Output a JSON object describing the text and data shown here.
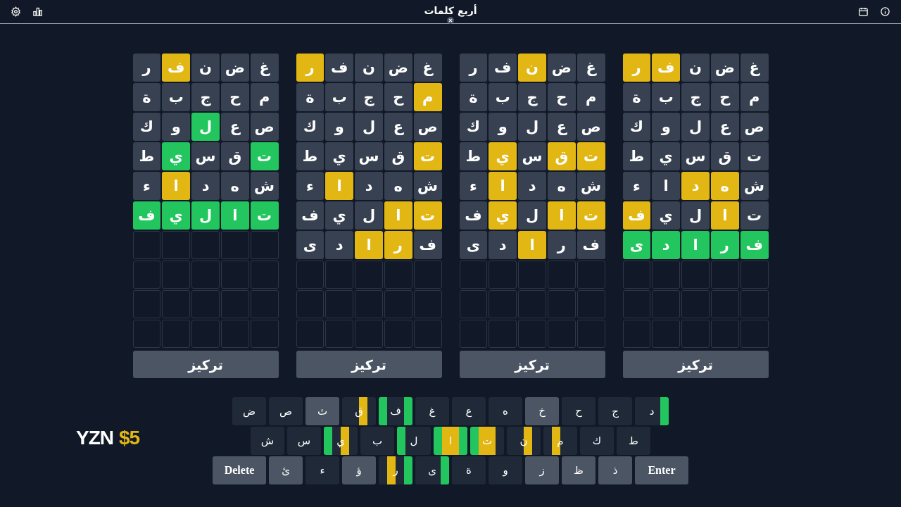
{
  "header": {
    "title": "أربع كلمات"
  },
  "boards": [
    {
      "rows": [
        {
          "tiles": [
            {
              "letter": "غ",
              "color": "#374151"
            },
            {
              "letter": "ض",
              "color": "#374151"
            },
            {
              "letter": "ن",
              "color": "#374151"
            },
            {
              "letter": "ف",
              "color": "#e2b714"
            },
            {
              "letter": "ر",
              "color": "#e2b714"
            }
          ]
        },
        {
          "tiles": [
            {
              "letter": "م",
              "color": "#374151"
            },
            {
              "letter": "ح",
              "color": "#374151"
            },
            {
              "letter": "ج",
              "color": "#374151"
            },
            {
              "letter": "ب",
              "color": "#374151"
            },
            {
              "letter": "ة",
              "color": "#374151"
            }
          ]
        },
        {
          "tiles": [
            {
              "letter": "ص",
              "color": "#374151"
            },
            {
              "letter": "ع",
              "color": "#374151"
            },
            {
              "letter": "ل",
              "color": "#374151"
            },
            {
              "letter": "و",
              "color": "#374151"
            },
            {
              "letter": "ك",
              "color": "#374151"
            }
          ]
        },
        {
          "tiles": [
            {
              "letter": "ت",
              "color": "#374151"
            },
            {
              "letter": "ق",
              "color": "#374151"
            },
            {
              "letter": "س",
              "color": "#374151"
            },
            {
              "letter": "ي",
              "color": "#374151"
            },
            {
              "letter": "ط",
              "color": "#374151"
            }
          ]
        },
        {
          "tiles": [
            {
              "letter": "ش",
              "color": "#374151"
            },
            {
              "letter": "ه",
              "color": "#e2b714"
            },
            {
              "letter": "د",
              "color": "#e2b714"
            },
            {
              "letter": "ا",
              "color": "#374151"
            },
            {
              "letter": "ء",
              "color": "#374151"
            }
          ]
        },
        {
          "tiles": [
            {
              "letter": "ت",
              "color": "#374151"
            },
            {
              "letter": "ا",
              "color": "#e2b714"
            },
            {
              "letter": "ل",
              "color": "#374151"
            },
            {
              "letter": "ي",
              "color": "#374151"
            },
            {
              "letter": "ف",
              "color": "#e2b714"
            }
          ]
        },
        {
          "tiles": [
            {
              "letter": "ف",
              "color": "#22c55e"
            },
            {
              "letter": "ر",
              "color": "#22c55e"
            },
            {
              "letter": "ا",
              "color": "#22c55e"
            },
            {
              "letter": "د",
              "color": "#22c55e"
            },
            {
              "letter": "ى",
              "color": "#22c55e"
            }
          ]
        }
      ],
      "focus": "تركيز"
    },
    {
      "rows": [
        {
          "tiles": [
            {
              "letter": "غ",
              "color": "#374151"
            },
            {
              "letter": "ض",
              "color": "#374151"
            },
            {
              "letter": "ن",
              "color": "#e2b714"
            },
            {
              "letter": "ف",
              "color": "#374151"
            },
            {
              "letter": "ر",
              "color": "#374151"
            }
          ]
        },
        {
          "tiles": [
            {
              "letter": "م",
              "color": "#374151"
            },
            {
              "letter": "ح",
              "color": "#374151"
            },
            {
              "letter": "ج",
              "color": "#374151"
            },
            {
              "letter": "ب",
              "color": "#374151"
            },
            {
              "letter": "ة",
              "color": "#374151"
            }
          ]
        },
        {
          "tiles": [
            {
              "letter": "ص",
              "color": "#374151"
            },
            {
              "letter": "ع",
              "color": "#374151"
            },
            {
              "letter": "ل",
              "color": "#374151"
            },
            {
              "letter": "و",
              "color": "#374151"
            },
            {
              "letter": "ك",
              "color": "#374151"
            }
          ]
        },
        {
          "tiles": [
            {
              "letter": "ت",
              "color": "#e2b714"
            },
            {
              "letter": "ق",
              "color": "#e2b714"
            },
            {
              "letter": "س",
              "color": "#374151"
            },
            {
              "letter": "ي",
              "color": "#e2b714"
            },
            {
              "letter": "ط",
              "color": "#374151"
            }
          ]
        },
        {
          "tiles": [
            {
              "letter": "ش",
              "color": "#374151"
            },
            {
              "letter": "ه",
              "color": "#374151"
            },
            {
              "letter": "د",
              "color": "#374151"
            },
            {
              "letter": "ا",
              "color": "#e2b714"
            },
            {
              "letter": "ء",
              "color": "#374151"
            }
          ]
        },
        {
          "tiles": [
            {
              "letter": "ت",
              "color": "#e2b714"
            },
            {
              "letter": "ا",
              "color": "#e2b714"
            },
            {
              "letter": "ل",
              "color": "#374151"
            },
            {
              "letter": "ي",
              "color": "#e2b714"
            },
            {
              "letter": "ف",
              "color": "#374151"
            }
          ]
        },
        {
          "tiles": [
            {
              "letter": "ف",
              "color": "#374151"
            },
            {
              "letter": "ر",
              "color": "#374151"
            },
            {
              "letter": "ا",
              "color": "#e2b714"
            },
            {
              "letter": "د",
              "color": "#374151"
            },
            {
              "letter": "ى",
              "color": "#374151"
            }
          ]
        }
      ],
      "focus": "تركيز"
    },
    {
      "rows": [
        {
          "tiles": [
            {
              "letter": "غ",
              "color": "#374151"
            },
            {
              "letter": "ض",
              "color": "#374151"
            },
            {
              "letter": "ن",
              "color": "#374151"
            },
            {
              "letter": "ف",
              "color": "#374151"
            },
            {
              "letter": "ر",
              "color": "#e2b714"
            }
          ]
        },
        {
          "tiles": [
            {
              "letter": "م",
              "color": "#e2b714"
            },
            {
              "letter": "ح",
              "color": "#374151"
            },
            {
              "letter": "ج",
              "color": "#374151"
            },
            {
              "letter": "ب",
              "color": "#374151"
            },
            {
              "letter": "ة",
              "color": "#374151"
            }
          ]
        },
        {
          "tiles": [
            {
              "letter": "ص",
              "color": "#374151"
            },
            {
              "letter": "ع",
              "color": "#374151"
            },
            {
              "letter": "ل",
              "color": "#374151"
            },
            {
              "letter": "و",
              "color": "#374151"
            },
            {
              "letter": "ك",
              "color": "#374151"
            }
          ]
        },
        {
          "tiles": [
            {
              "letter": "ت",
              "color": "#e2b714"
            },
            {
              "letter": "ق",
              "color": "#374151"
            },
            {
              "letter": "س",
              "color": "#374151"
            },
            {
              "letter": "ي",
              "color": "#374151"
            },
            {
              "letter": "ط",
              "color": "#374151"
            }
          ]
        },
        {
          "tiles": [
            {
              "letter": "ش",
              "color": "#374151"
            },
            {
              "letter": "ه",
              "color": "#374151"
            },
            {
              "letter": "د",
              "color": "#374151"
            },
            {
              "letter": "ا",
              "color": "#e2b714"
            },
            {
              "letter": "ء",
              "color": "#374151"
            }
          ]
        },
        {
          "tiles": [
            {
              "letter": "ت",
              "color": "#e2b714"
            },
            {
              "letter": "ا",
              "color": "#e2b714"
            },
            {
              "letter": "ل",
              "color": "#374151"
            },
            {
              "letter": "ي",
              "color": "#374151"
            },
            {
              "letter": "ف",
              "color": "#374151"
            }
          ]
        },
        {
          "tiles": [
            {
              "letter": "ف",
              "color": "#374151"
            },
            {
              "letter": "ر",
              "color": "#e2b714"
            },
            {
              "letter": "ا",
              "color": "#e2b714"
            },
            {
              "letter": "د",
              "color": "#374151"
            },
            {
              "letter": "ى",
              "color": "#374151"
            }
          ]
        }
      ],
      "focus": "تركيز"
    },
    {
      "rows": [
        {
          "tiles": [
            {
              "letter": "غ",
              "color": "#374151"
            },
            {
              "letter": "ض",
              "color": "#374151"
            },
            {
              "letter": "ن",
              "color": "#374151"
            },
            {
              "letter": "ف",
              "color": "#e2b714"
            },
            {
              "letter": "ر",
              "color": "#374151"
            }
          ]
        },
        {
          "tiles": [
            {
              "letter": "م",
              "color": "#374151"
            },
            {
              "letter": "ح",
              "color": "#374151"
            },
            {
              "letter": "ج",
              "color": "#374151"
            },
            {
              "letter": "ب",
              "color": "#374151"
            },
            {
              "letter": "ة",
              "color": "#374151"
            }
          ]
        },
        {
          "tiles": [
            {
              "letter": "ص",
              "color": "#374151"
            },
            {
              "letter": "ع",
              "color": "#374151"
            },
            {
              "letter": "ل",
              "color": "#22c55e"
            },
            {
              "letter": "و",
              "color": "#374151"
            },
            {
              "letter": "ك",
              "color": "#374151"
            }
          ]
        },
        {
          "tiles": [
            {
              "letter": "ت",
              "color": "#22c55e"
            },
            {
              "letter": "ق",
              "color": "#374151"
            },
            {
              "letter": "س",
              "color": "#374151"
            },
            {
              "letter": "ي",
              "color": "#22c55e"
            },
            {
              "letter": "ط",
              "color": "#374151"
            }
          ]
        },
        {
          "tiles": [
            {
              "letter": "ش",
              "color": "#374151"
            },
            {
              "letter": "ه",
              "color": "#374151"
            },
            {
              "letter": "د",
              "color": "#374151"
            },
            {
              "letter": "ا",
              "color": "#e2b714"
            },
            {
              "letter": "ء",
              "color": "#374151"
            }
          ]
        },
        {
          "tiles": [
            {
              "letter": "ت",
              "color": "#22c55e"
            },
            {
              "letter": "ا",
              "color": "#22c55e"
            },
            {
              "letter": "ل",
              "color": "#22c55e"
            },
            {
              "letter": "ي",
              "color": "#22c55e"
            },
            {
              "letter": "ف",
              "color": "#22c55e"
            }
          ]
        }
      ],
      "focus": "تركيز"
    }
  ],
  "keyboard": [
    [
      {
        "label": "د",
        "used": true,
        "segments": [
          {
            "color": "#22c55e"
          },
          {
            "color": "#1f2937"
          },
          {
            "color": "#1f2937"
          },
          {
            "color": "#1f2937"
          }
        ]
      },
      {
        "label": "ج",
        "used": true
      },
      {
        "label": "ح",
        "used": true
      },
      {
        "label": "خ",
        "used": false
      },
      {
        "label": "ه",
        "used": true
      },
      {
        "label": "ع",
        "used": true
      },
      {
        "label": "غ",
        "used": true
      },
      {
        "label": "ف",
        "used": true,
        "segments": [
          {
            "color": "#22c55e"
          },
          {
            "color": "#1f2937"
          },
          {
            "color": "#1f2937"
          },
          {
            "color": "#22c55e"
          }
        ]
      },
      {
        "label": "ق",
        "used": true,
        "segments": [
          {
            "color": "#1f2937"
          },
          {
            "color": "#e2b714"
          },
          {
            "color": "#1f2937"
          },
          {
            "color": "#1f2937"
          }
        ]
      },
      {
        "label": "ث",
        "used": false
      },
      {
        "label": "ص",
        "used": true
      },
      {
        "label": "ض",
        "used": true
      }
    ],
    [
      {
        "label": "ط",
        "used": true
      },
      {
        "label": "ك",
        "used": true
      },
      {
        "label": "م",
        "used": true,
        "segments": [
          {
            "color": "#1f2937"
          },
          {
            "color": "#1f2937"
          },
          {
            "color": "#e2b714"
          },
          {
            "color": "#1f2937"
          }
        ]
      },
      {
        "label": "ن",
        "used": true,
        "segments": [
          {
            "color": "#1f2937"
          },
          {
            "color": "#e2b714"
          },
          {
            "color": "#1f2937"
          },
          {
            "color": "#1f2937"
          }
        ]
      },
      {
        "label": "ت",
        "used": true,
        "segments": [
          {
            "color": "#1f2937"
          },
          {
            "color": "#e2b714"
          },
          {
            "color": "#e2b714"
          },
          {
            "color": "#22c55e"
          }
        ]
      },
      {
        "label": "ا",
        "segments": [
          {
            "color": "#22c55e"
          },
          {
            "color": "#e2b714"
          },
          {
            "color": "#e2b714"
          },
          {
            "color": "#22c55e"
          }
        ]
      },
      {
        "label": "ل",
        "used": true,
        "segments": [
          {
            "color": "#1f2937"
          },
          {
            "color": "#1f2937"
          },
          {
            "color": "#1f2937"
          },
          {
            "color": "#22c55e"
          }
        ]
      },
      {
        "label": "ب",
        "used": true
      },
      {
        "label": "ي",
        "used": true,
        "segments": [
          {
            "color": "#1f2937"
          },
          {
            "color": "#e2b714"
          },
          {
            "color": "#1f2937"
          },
          {
            "color": "#22c55e"
          }
        ]
      },
      {
        "label": "س",
        "used": true
      },
      {
        "label": "ش",
        "used": true
      }
    ],
    [
      {
        "label": "Enter",
        "kind": "action",
        "used": false
      },
      {
        "label": "ذ",
        "used": false
      },
      {
        "label": "ظ",
        "used": false
      },
      {
        "label": "ز",
        "used": false
      },
      {
        "label": "و",
        "used": true
      },
      {
        "label": "ة",
        "used": true
      },
      {
        "label": "ى",
        "used": true,
        "segments": [
          {
            "color": "#22c55e"
          },
          {
            "color": "#1f2937"
          },
          {
            "color": "#1f2937"
          },
          {
            "color": "#1f2937"
          }
        ]
      },
      {
        "label": "ر",
        "used": true,
        "segments": [
          {
            "color": "#22c55e"
          },
          {
            "color": "#1f2937"
          },
          {
            "color": "#e2b714"
          },
          {
            "color": "#1f2937"
          }
        ]
      },
      {
        "label": "ؤ",
        "used": false
      },
      {
        "label": "ء",
        "used": true
      },
      {
        "label": "ئ",
        "used": false
      },
      {
        "label": "Delete",
        "kind": "action",
        "used": false
      }
    ]
  ],
  "overlay": {
    "name": "YZN",
    "price": "$5"
  }
}
